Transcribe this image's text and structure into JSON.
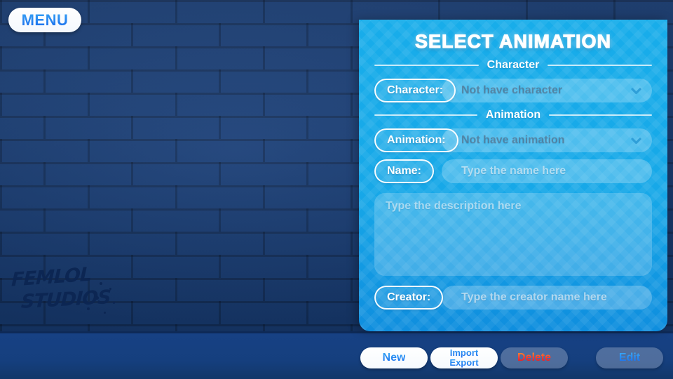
{
  "menu": {
    "label": "MENU"
  },
  "watermark": {
    "line1": "FEMLOL",
    "line2": "STUDIOS"
  },
  "panel": {
    "title": "SELECT ANIMATION",
    "sections": [
      {
        "heading": "Character"
      },
      {
        "heading": "Animation"
      }
    ],
    "fields": {
      "character": {
        "label": "Character:",
        "value": "Not have character",
        "icon": "chevron-down-icon"
      },
      "animation": {
        "label": "Animation:",
        "value": "Not have animation",
        "icon": "chevron-down-icon"
      },
      "name": {
        "label": "Name:",
        "placeholder": "Type the name here"
      },
      "description": {
        "placeholder": "Type the description here"
      },
      "creator": {
        "label": "Creator:",
        "placeholder": "Type the creator name here"
      }
    }
  },
  "actions": {
    "new": {
      "label": "New"
    },
    "import_export": {
      "line1": "Import",
      "line2": "Export"
    },
    "delete": {
      "label": "Delete"
    },
    "edit": {
      "label": "Edit"
    }
  },
  "colors": {
    "panel_blue": "#17a8e8",
    "wall_blue": "#19407c",
    "bottom_bar": "#153f7e",
    "accent_text": "#1567ed",
    "danger_text": "#fb2d2d",
    "graffiti": "#0c2552"
  }
}
